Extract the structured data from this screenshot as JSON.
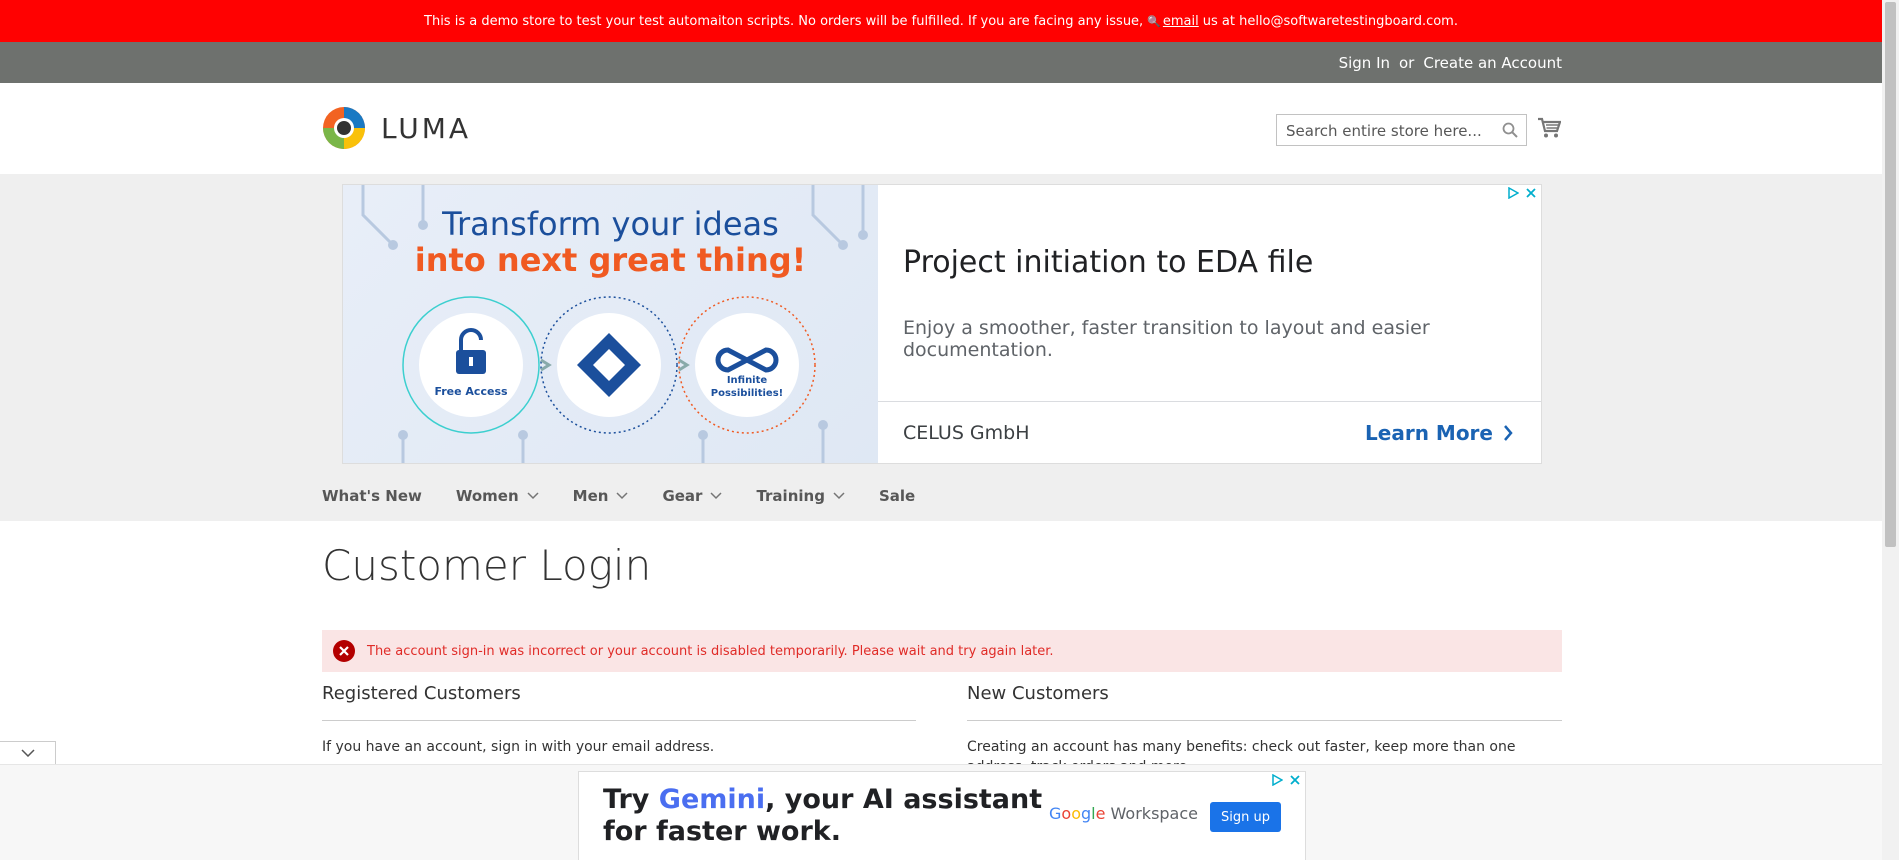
{
  "demo_notice": {
    "text_before": "This is a demo store to test your test automaiton scripts. No orders will be fulfilled. If you are facing any issue,",
    "link": "email",
    "text_after": "us at hello@softwaretestingboard.com."
  },
  "header_links": {
    "sign_in": "Sign In",
    "or": "or",
    "create_account": "Create an Account"
  },
  "logo": {
    "text": "LUMA"
  },
  "search": {
    "placeholder": "Search entire store here..."
  },
  "ad": {
    "image_line1": "Transform your ideas",
    "image_line2": "into next great thing!",
    "step1": "Free Access",
    "step3_a": "Infinite",
    "step3_b": "Possibilities!",
    "headline": "Project initiation to EDA file",
    "description": "Enjoy a smoother, faster transition to layout and easier documentation.",
    "advertiser": "CELUS GmbH",
    "cta": "Learn More"
  },
  "nav": {
    "items": [
      "What's New",
      "Women",
      "Men",
      "Gear",
      "Training",
      "Sale"
    ]
  },
  "page": {
    "title": "Customer Login"
  },
  "error": {
    "message": "The account sign-in was incorrect or your account is disabled temporarily. Please wait and try again later."
  },
  "registered": {
    "title": "Registered Customers",
    "text": "If you have an account, sign in with your email address."
  },
  "new_customers": {
    "title": "New Customers",
    "text": "Creating an account has many benefits: check out faster, keep more than one address, track orders and more."
  },
  "bottom_ad": {
    "line1_a": "Try ",
    "gemini": "Gemini",
    "line1_b": ", your AI assistant",
    "line2": "for faster work.",
    "brand_workspace": "Workspace",
    "button": "Sign up"
  },
  "colors": {
    "demo_bar": "#ff0101",
    "panel": "#6e716e",
    "error_bg": "#fae5e5",
    "error_text": "#e02b27"
  }
}
